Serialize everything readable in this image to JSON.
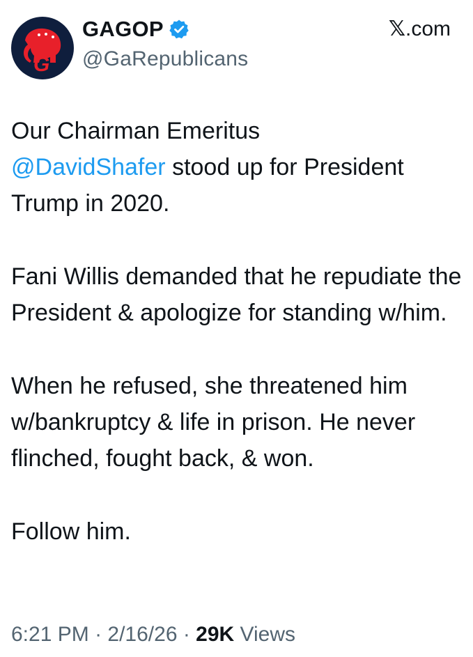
{
  "account": {
    "display_name": "GAGOP",
    "handle": "@GaRepublicans",
    "verified": true,
    "avatar_icon": "gagop-elephant-logo",
    "avatar_letter": "G"
  },
  "source": {
    "x_mark": "𝕏",
    "domain_suffix": ".com"
  },
  "post": {
    "paragraph_1": {
      "before_mention": "Our Chairman Emeritus",
      "mention": "@DavidShafer",
      "after_mention": " stood up for President Trump in 2020."
    },
    "paragraph_2": "Fani Willis demanded that he repudiate the President & apologize for standing w/him.",
    "paragraph_3": "When he refused, she threatened him w/bankruptcy & life in prison. He never flinched, fought back, & won.",
    "paragraph_4": "Follow him."
  },
  "meta": {
    "time": "6:21 PM",
    "separator": " · ",
    "date": "2/16/26",
    "views_count": "29K",
    "views_label": " Views"
  },
  "colors": {
    "text": "#0f1419",
    "secondary_text": "#536471",
    "mention": "#1d9bf0",
    "verified_badge": "#1d9bf0",
    "avatar_background": "#0f1e3d",
    "logo_red": "#e8202a"
  }
}
